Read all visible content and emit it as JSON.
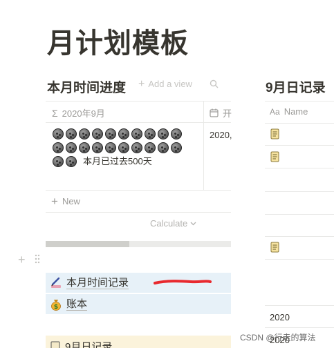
{
  "page": {
    "title": "月计划模板"
  },
  "left_view": {
    "title": "本月时间进度",
    "add_view_label": "Add a view",
    "columns": [
      {
        "label": "2020年9月",
        "icon": "sigma-icon"
      },
      {
        "label": "开",
        "icon": "calendar-icon"
      }
    ],
    "row": {
      "elapsed_units": 22,
      "progress_text": "本月已过去500天",
      "date_cell": "2020,"
    },
    "new_label": "New",
    "calculate_label": "Calculate",
    "scrollbar_position": 0.45
  },
  "right_view": {
    "title": "9月日记录",
    "columns": [
      {
        "label": "Name",
        "icon": "text-property-icon"
      }
    ],
    "rows_with_icon": 3,
    "year_cells": [
      "2020",
      "2020"
    ]
  },
  "links": [
    {
      "label": "本月时间记录",
      "icon": "writing-icon"
    },
    {
      "label": "账本",
      "icon": "money-bag-icon"
    },
    {
      "label": "9月日记录",
      "icon": "notebook-icon"
    }
  ],
  "watermark": "CSDN @行走的算法",
  "colors": {
    "link_bg": "#e7f1f8",
    "callout_bg": "#fbf3db",
    "annotation_red": "#e8292e"
  }
}
